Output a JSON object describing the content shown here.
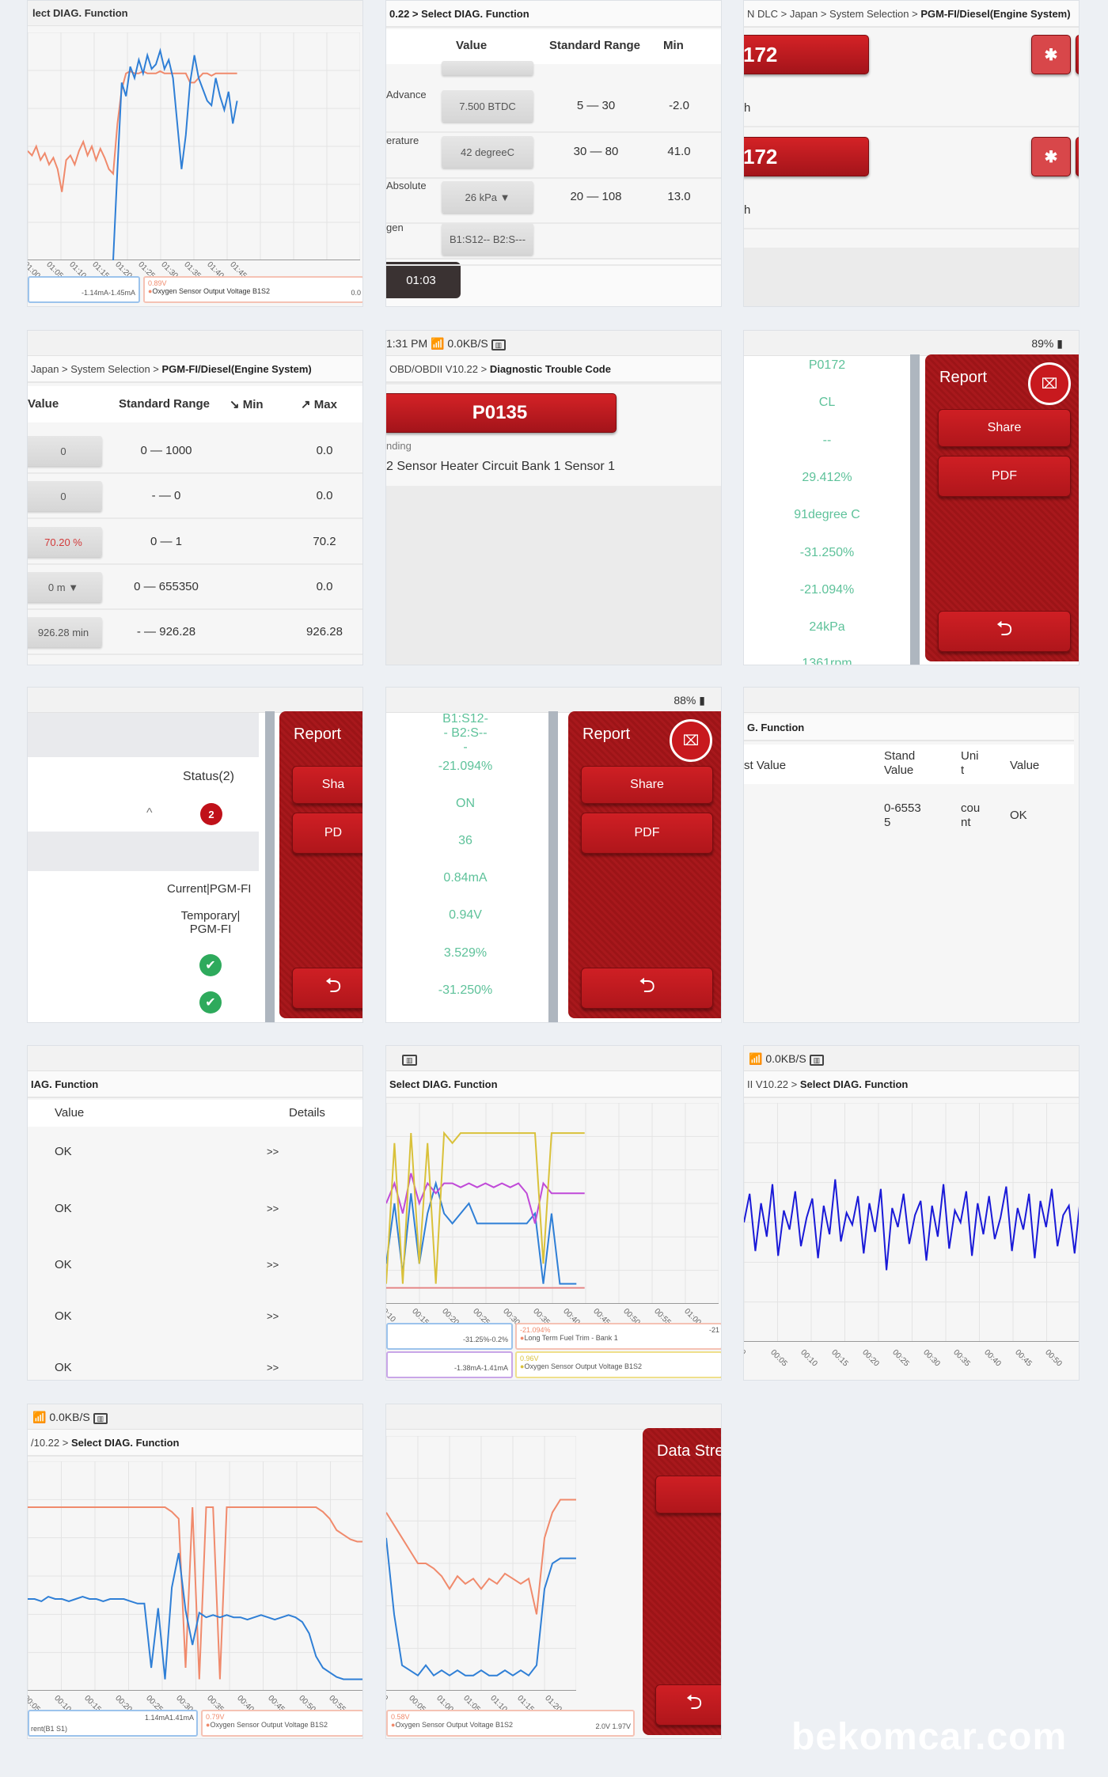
{
  "colors": {
    "accent_red": "#b3161b",
    "value_green": "#5ec29a",
    "orange": "#f08a6c",
    "blue": "#2f7fd6"
  },
  "t1": {
    "title": "lect DIAG. Function",
    "ticks": [
      "01:00",
      "01:05",
      "01:10",
      "01:15",
      "01:20",
      "01:25",
      "01:30",
      "01:35",
      "01:40",
      "01:45"
    ],
    "legend_left": "-1.14mA-1.45mA",
    "legend_value": "0.89V",
    "legend_name": "Oxygen Sensor Output Voltage B1S2",
    "legend_edge": "0.0",
    "chart": {
      "type": "line",
      "ylim": [
        0,
        100
      ],
      "orange": [
        48,
        46,
        50,
        44,
        47,
        42,
        45,
        40,
        30,
        44,
        46,
        42,
        48,
        52,
        46,
        50,
        44,
        49,
        45,
        40,
        38,
        60,
        75,
        82,
        83,
        82,
        82,
        83,
        82,
        82,
        82,
        83,
        82,
        82,
        82,
        82,
        82,
        82,
        78,
        78,
        80,
        82,
        82,
        81,
        82,
        82,
        82,
        82,
        82,
        82
      ],
      "blue": [
        null,
        null,
        null,
        null,
        null,
        null,
        null,
        null,
        null,
        null,
        null,
        null,
        null,
        null,
        null,
        null,
        null,
        null,
        null,
        null,
        0,
        40,
        78,
        72,
        85,
        80,
        88,
        82,
        90,
        84,
        86,
        92,
        84,
        88,
        80,
        60,
        40,
        55,
        78,
        90,
        80,
        75,
        70,
        68,
        80,
        72,
        66,
        74,
        60,
        70
      ]
    }
  },
  "t2": {
    "crumb": "0.22 > Select DIAG. Function",
    "headers": [
      "Value",
      "Standard Range",
      "Min"
    ],
    "rows": [
      {
        "label": "Advance",
        "value": "7.500 BTDC",
        "range": "5 — 30",
        "min": "-2.0"
      },
      {
        "label": "erature",
        "value": "42 degreeC",
        "range": "30 — 80",
        "min": "41.0"
      },
      {
        "label": "Absolute",
        "value": "26 kPa ▼",
        "range": "20 — 108",
        "min": "13.0"
      },
      {
        "label": "gen",
        "value": "B1:S12-- B2:S---",
        "range": "",
        "min": ""
      }
    ],
    "timer": "01:03"
  },
  "t3": {
    "crumb_pre": "N DLC > Japan > System Selection > ",
    "crumb_bold": "PGM-FI/Diesel(Engine System)",
    "dtcs": [
      {
        "code": "172",
        "sub": "h"
      },
      {
        "code": "172",
        "sub": "h"
      }
    ],
    "icon": "freeze-frame-icon"
  },
  "t4": {
    "crumb_pre": "Japan > System Selection > ",
    "crumb_bold": "PGM-FI/Diesel(Engine System)",
    "headers": [
      "Value",
      "Standard Range",
      "↘ Min",
      "↗ Max"
    ],
    "rows": [
      {
        "value": "0",
        "range": "0 — 1000",
        "max": "0.0"
      },
      {
        "value": "0",
        "range": "- — 0",
        "max": "0.0"
      },
      {
        "value": "70.20 %",
        "range": "0 — 1",
        "max": "70.2"
      },
      {
        "value": "0 m ▼",
        "range": "0 — 655350",
        "max": "0.0"
      },
      {
        "value": "926.28 min",
        "range": "- — 926.28",
        "max": "926.28"
      }
    ]
  },
  "t5": {
    "time": "1:31 PM",
    "speed": "0.0KB/S",
    "crumb_pre": "OBD/OBDII V10.22 > ",
    "crumb_bold": "Diagnostic Trouble Code",
    "code": "P0135",
    "status": "nding",
    "desc": "2 Sensor Heater Circuit Bank 1 Sensor 1"
  },
  "t6": {
    "battery": "89%",
    "values": [
      "P0172",
      "CL",
      "--",
      "29.412%",
      "91degree C",
      "-31.250%",
      "-21.094%",
      "24kPa",
      "1361rpm"
    ],
    "report": "Report",
    "share": "Share",
    "pdf": "PDF"
  },
  "t7": {
    "status": "Status(2)",
    "badge": "2",
    "current": "Current|PGM-FI",
    "temporary": "Temporary| PGM-FI",
    "report": "Report",
    "share": "Sha",
    "pdf": "PD"
  },
  "t8": {
    "battery": "88%",
    "values": [
      "B1:S12-- B2:S---",
      "-21.094%",
      "ON",
      "36",
      "0.84mA",
      "0.94V",
      "3.529%",
      "-31.250%"
    ],
    "report": "Report",
    "share": "Share",
    "pdf": "PDF"
  },
  "t9": {
    "title": "G. Function",
    "headers": [
      "st Value",
      "Stand Value",
      "Uni t",
      "Value"
    ],
    "row": [
      "",
      "0-6553 5",
      "cou nt",
      "OK"
    ]
  },
  "t10": {
    "title": "IAG. Function",
    "headers": [
      "Value",
      "Details"
    ],
    "rows": [
      "OK",
      "OK",
      "OK",
      "OK",
      "OK"
    ],
    "details": ">>"
  },
  "t11": {
    "title": "Select DIAG. Function",
    "ticks": [
      "0:10",
      "00:15",
      "00:20",
      "00:25",
      "00:30",
      "00:35",
      "00:40",
      "00:45",
      "00:50",
      "00:55",
      "01:00"
    ],
    "legends": [
      {
        "left": "-31.25%-0.2%",
        "value": "-21.094%",
        "name": "Long Term Fuel Trim - Bank 1",
        "edge": "-21"
      },
      {
        "left": "-1.38mA-1.41mA",
        "value": "0.96V",
        "name": "Oxygen Sensor Output Voltage B1S2"
      }
    ],
    "chart": {
      "type": "line",
      "ylim": [
        0,
        100
      ],
      "yellow": [
        10,
        80,
        10,
        85,
        20,
        80,
        10,
        85,
        80,
        85,
        85,
        85,
        85,
        85,
        85,
        85,
        85,
        85,
        85,
        20,
        85,
        85,
        85,
        85,
        85,
        null,
        null,
        null,
        null,
        null,
        null,
        null,
        null,
        null,
        null,
        null,
        null,
        null,
        null,
        null
      ],
      "purple": [
        50,
        60,
        45,
        65,
        50,
        60,
        55,
        60,
        60,
        58,
        60,
        58,
        60,
        58,
        60,
        58,
        60,
        55,
        40,
        60,
        55,
        55,
        55,
        55,
        55,
        null,
        null,
        null,
        null,
        null,
        null,
        null,
        null,
        null,
        null,
        null,
        null,
        null,
        null,
        null
      ],
      "blue": [
        20,
        50,
        15,
        55,
        20,
        45,
        60,
        45,
        40,
        45,
        50,
        40,
        40,
        40,
        40,
        40,
        40,
        40,
        45,
        10,
        45,
        10,
        10,
        10,
        null,
        null,
        null,
        null,
        null,
        null,
        null,
        null,
        null,
        null,
        null,
        null,
        null,
        null,
        null,
        null
      ],
      "red": [
        8,
        8,
        8,
        8,
        8,
        8,
        8,
        8,
        8,
        8,
        8,
        8,
        8,
        8,
        8,
        8,
        8,
        8,
        8,
        8,
        8,
        8,
        8,
        8,
        8,
        null,
        null,
        null,
        null,
        null,
        null,
        null,
        null,
        null,
        null,
        null,
        null,
        null,
        null,
        null
      ]
    }
  },
  "t12": {
    "speed": "0.0KB/S",
    "crumb_pre": "II V10.22 > ",
    "crumb_bold": "Select DIAG. Function",
    "ticks": [
      "0",
      "00:05",
      "00:10",
      "00:15",
      "00:20",
      "00:25",
      "00:30",
      "00:35",
      "00:40",
      "00:45",
      "00:50"
    ],
    "chart": {
      "type": "line",
      "ylim": [
        0,
        100
      ],
      "blue": [
        50,
        62,
        38,
        58,
        44,
        66,
        36,
        55,
        47,
        63,
        40,
        52,
        60,
        35,
        57,
        45,
        68,
        42,
        54,
        49,
        61,
        37,
        58,
        46,
        64,
        30,
        56,
        48,
        62,
        41,
        53,
        59,
        34,
        57,
        44,
        66,
        39,
        55,
        50,
        63,
        36,
        58,
        45,
        61,
        43,
        52,
        65,
        38,
        56,
        47,
        62,
        35,
        59,
        48,
        64,
        40,
        53,
        57,
        37,
        60
      ]
    }
  },
  "t13": {
    "speed": "0.0KB/S",
    "crumb_pre": "/10.22 > ",
    "crumb_bold": "Select DIAG. Function",
    "ticks": [
      "00:05",
      "00:10",
      "00:15",
      "00:20",
      "00:25",
      "00:30",
      "00:35",
      "00:40",
      "00:45",
      "00:50",
      "00:55"
    ],
    "legend_left_name": "rent(B1 S1)",
    "legend_left": "1.14mA1.41mA",
    "legend_value": "0.79V",
    "legend_name": "Oxygen Sensor Output Voltage B1S2",
    "chart": {
      "type": "line",
      "ylim": [
        0,
        100
      ],
      "red": [
        80,
        80,
        80,
        80,
        80,
        80,
        80,
        80,
        80,
        80,
        80,
        80,
        80,
        80,
        80,
        80,
        80,
        80,
        80,
        80,
        80,
        78,
        75,
        10,
        80,
        5,
        80,
        80,
        5,
        80,
        80,
        80,
        80,
        80,
        80,
        80,
        80,
        80,
        80,
        80,
        80,
        80,
        80,
        78,
        75,
        70,
        68,
        66,
        65,
        65
      ],
      "blue": [
        40,
        40,
        39,
        41,
        40,
        40,
        39,
        40,
        41,
        40,
        40,
        39,
        40,
        40,
        40,
        39,
        38,
        38,
        10,
        36,
        5,
        45,
        60,
        35,
        20,
        34,
        32,
        33,
        32,
        33,
        32,
        32,
        31,
        32,
        33,
        32,
        31,
        32,
        33,
        32,
        30,
        25,
        15,
        10,
        8,
        6,
        5,
        5,
        5,
        5
      ]
    }
  },
  "t14": {
    "panel": "Data Stre",
    "ticks": [
      "0",
      "00:05",
      "01:00",
      "01:05",
      "01:10",
      "01:15",
      "01:20"
    ],
    "legend_value": "0.58V",
    "legend_name": "Oxygen Sensor Output Voltage B1S2",
    "legend_right": "2.0V 1.97V",
    "chart": {
      "type": "line",
      "ylim": [
        0,
        100
      ],
      "red": [
        70,
        65,
        60,
        55,
        50,
        50,
        48,
        45,
        40,
        45,
        42,
        44,
        40,
        44,
        42,
        46,
        44,
        42,
        44,
        30,
        60,
        70,
        75,
        75,
        75
      ],
      "blue": [
        60,
        30,
        10,
        8,
        6,
        10,
        6,
        8,
        6,
        8,
        6,
        6,
        8,
        6,
        6,
        8,
        6,
        8,
        6,
        10,
        40,
        50,
        52,
        52,
        52
      ]
    }
  },
  "watermark": "bekomcar.com"
}
